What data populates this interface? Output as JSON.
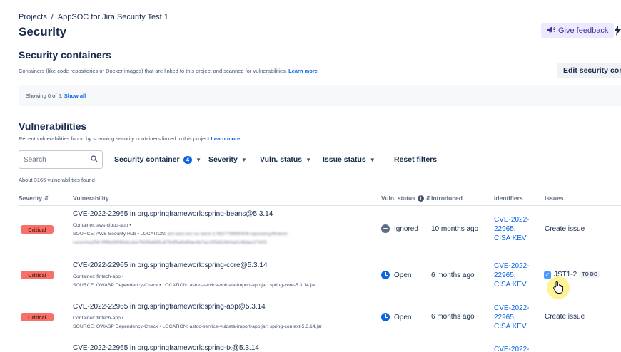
{
  "breadcrumb": {
    "projects": "Projects",
    "separator": "/",
    "project": "AppSOC for Jira Security Test 1"
  },
  "page_title": "Security",
  "header": {
    "feedback_label": "Give feedback",
    "feedback_icon": "megaphone-icon",
    "extra_icon": "bolt-icon"
  },
  "containers": {
    "title": "Security containers",
    "description": "Containers (like code repositories or Docker images) that are linked to this project and scanned for vulnerabilities.",
    "learn_more": "Learn more",
    "edit_button": "Edit security conta",
    "showing": "Showing 0 of 5.",
    "show_all": "Show all"
  },
  "vulnerabilities": {
    "title": "Vulnerabilities",
    "description": "Recent vulnerabilities found by scanning security containers linked to this project",
    "learn_more": "Learn more",
    "search_placeholder": "Search",
    "filters": {
      "security_container": "Security container",
      "security_container_count": "4",
      "severity": "Severity",
      "vuln_status": "Vuln. status",
      "issue_status": "Issue status",
      "reset": "Reset filters"
    },
    "found_text": "About 3165 vulnerabilities found",
    "columns": {
      "severity": "Severity",
      "vulnerability": "Vulnerability",
      "vuln_status": "Vuln. status",
      "introduced": "Introduced",
      "identifiers": "Identifiers",
      "issues": "Issues"
    },
    "rows": [
      {
        "severity": "Critical",
        "name": "CVE-2022-22965 in org.springframework:spring-beans@5.3.14",
        "container": "Container: aws-cloud-app •",
        "source": "SOURCE: AWS Security Hub • LOCATION:",
        "location_blurred": "arn:aws:ecr:us-west-2:482778895409:repository/fintech-",
        "location_blurred_2": "core/sha256:0ff9b3905b6ccba7609fa685c8784f5a9d6fae4b7ac1f0b824b0ad148dac27403",
        "status": "Ignored",
        "introduced": "10 months ago",
        "identifiers": [
          "CVE-2022-",
          "22965,",
          "CISA KEV"
        ],
        "issue": "Create issue"
      },
      {
        "severity": "Critical",
        "name": "CVE-2022-22965 in org.springframework:spring-core@5.3.14",
        "container": "Container: fintech-app •",
        "source": "SOURCE: OWASP Dependency-Check • LOCATION: astoc-service-vuldata-import-app.jar: spring-core-5.3.14.jar",
        "status": "Open",
        "introduced": "6 months ago",
        "identifiers": [
          "CVE-2022-",
          "22965,",
          "CISA KEV"
        ],
        "issue_key": "JST1-2",
        "issue_status": "TO DO"
      },
      {
        "severity": "Critical",
        "name": "CVE-2022-22965 in org.springframework:spring-aop@5.3.14",
        "container": "Container: fintech-app •",
        "source": "SOURCE: OWASP Dependency-Check • LOCATION: astoc-service-vuldata-import-app.jar: spring-context-5.3.14.jar",
        "status": "Open",
        "introduced": "6 months ago",
        "identifiers": [
          "CVE-2022-",
          "22965,",
          "CISA KEV"
        ],
        "issue": "Create issue"
      },
      {
        "name": "CVE-2022-22965 in org.springframework:spring-tx@5.3.14",
        "identifiers": [
          "CVE-2022-"
        ]
      }
    ]
  },
  "colors": {
    "critical": "#f87168",
    "link": "#0c66e4",
    "open": "#0c66e4",
    "ignored": "#5e6c84",
    "feedback_bg": "#eceaff"
  }
}
